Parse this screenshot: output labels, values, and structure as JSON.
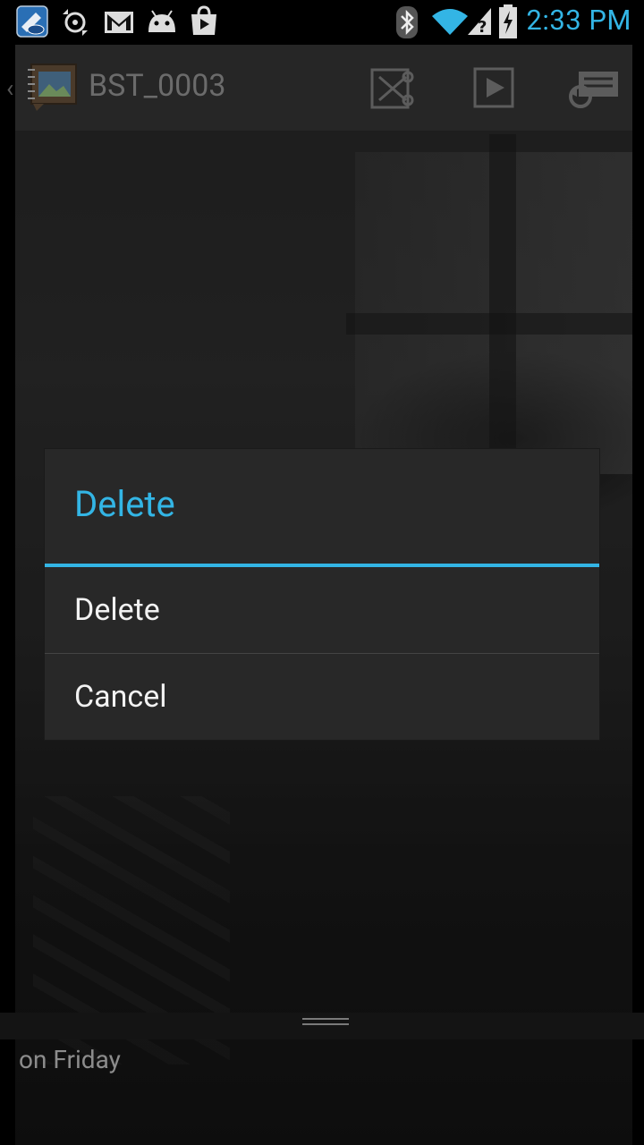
{
  "status_bar": {
    "time": "2:33 PM",
    "icons": [
      "intel-app-icon",
      "sync-icon",
      "gmail-icon",
      "android-icon",
      "play-store-icon",
      "bluetooth-icon",
      "wifi-icon",
      "signal-unknown-icon",
      "battery-charging-icon"
    ],
    "accent_color": "#33b5e5"
  },
  "action_bar": {
    "title": "BST_0003",
    "buttons": [
      "trim-icon",
      "play-icon",
      "sync-share-icon"
    ]
  },
  "dialog": {
    "title": "Delete",
    "items": [
      {
        "label": "Delete"
      },
      {
        "label": "Cancel"
      }
    ]
  },
  "footer": {
    "caption": "on Friday"
  }
}
